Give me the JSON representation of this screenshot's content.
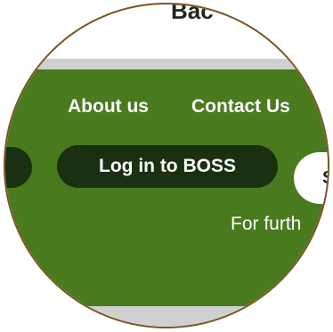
{
  "header": {
    "partial_heading": "Bac"
  },
  "nav": {
    "about_label": "About us",
    "contact_label": "Contact Us"
  },
  "buttons": {
    "login_label": "Log in to BOSS",
    "partial_right_label": "S"
  },
  "footer": {
    "partial_text": "For furth"
  },
  "colors": {
    "green": "#4a7a1e",
    "dark_button": "#1a3010",
    "border": "#7a5424",
    "band": "#d0d0d0"
  }
}
